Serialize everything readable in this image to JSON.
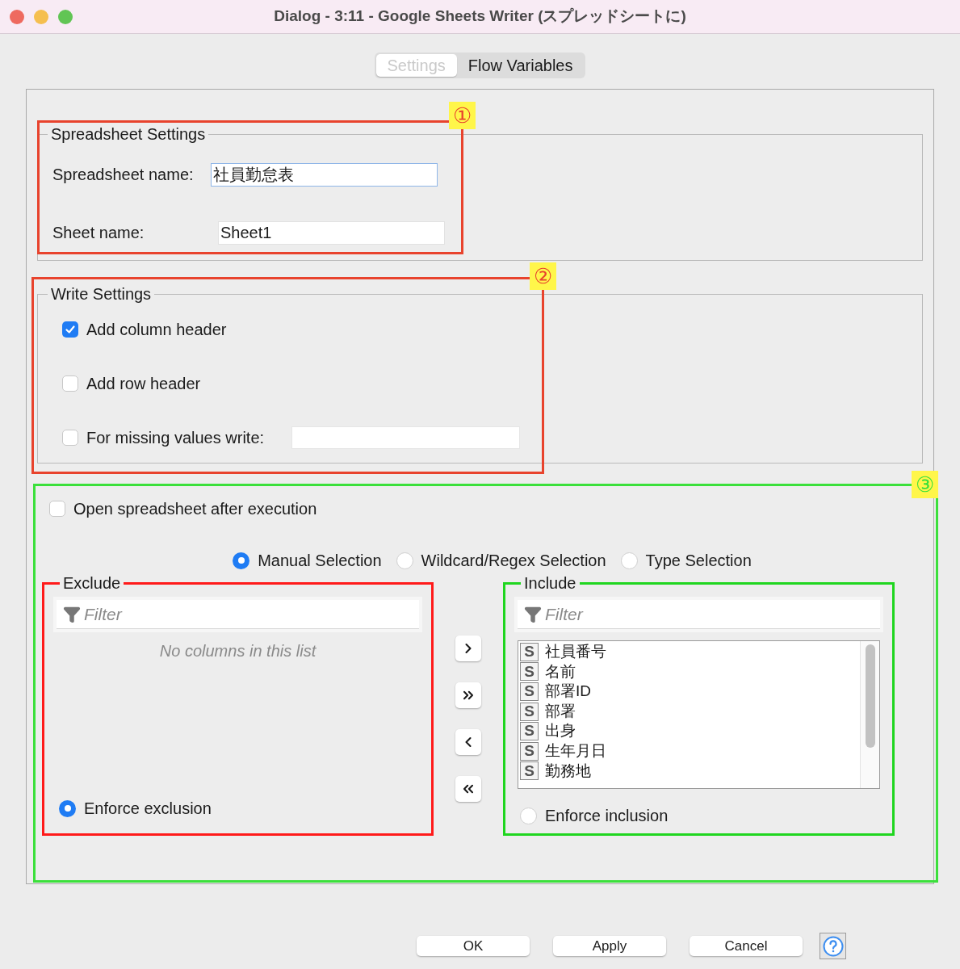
{
  "window": {
    "title": "Dialog - 3:11 - Google Sheets Writer (スプレッドシートに)"
  },
  "tabs": [
    {
      "label": "Settings",
      "selected": true
    },
    {
      "label": "Flow Variables",
      "selected": false
    }
  ],
  "spreadsheet_settings": {
    "title": "Spreadsheet Settings",
    "fields": [
      {
        "label": "Spreadsheet name:",
        "value": "社員勤怠表"
      },
      {
        "label": "Sheet name:",
        "value": "Sheet1"
      }
    ]
  },
  "write_settings": {
    "title": "Write Settings",
    "options": [
      {
        "label": "Add column header",
        "checked": true,
        "kind": "checkbox"
      },
      {
        "label": "Add row header",
        "checked": false,
        "kind": "checkbox"
      },
      {
        "label": "For missing values write:",
        "checked": false,
        "kind": "checkbox-field"
      }
    ]
  },
  "open_after_execution": {
    "label": "Open spreadsheet after execution",
    "checked": false
  },
  "selection_modes": [
    {
      "label": "Manual Selection",
      "selected": true
    },
    {
      "label": "Wildcard/Regex Selection",
      "selected": false
    },
    {
      "label": "Type Selection",
      "selected": false
    }
  ],
  "exclude": {
    "title": "Exclude",
    "filter_placeholder": "Filter",
    "empty_text": "No columns in this list",
    "enforce": {
      "label": "Enforce exclusion",
      "selected": true
    }
  },
  "include": {
    "title": "Include",
    "filter_placeholder": "Filter",
    "columns": [
      {
        "type": "S",
        "name": "社員番号"
      },
      {
        "type": "S",
        "name": "名前"
      },
      {
        "type": "S",
        "name": "部署ID"
      },
      {
        "type": "S",
        "name": "部署"
      },
      {
        "type": "S",
        "name": "出身"
      },
      {
        "type": "S",
        "name": "生年月日"
      },
      {
        "type": "S",
        "name": "勤務地"
      }
    ],
    "enforce": {
      "label": "Enforce inclusion",
      "selected": false
    }
  },
  "buttons": [
    "OK",
    "Apply",
    "Cancel"
  ],
  "annotations": [
    {
      "marker": "①",
      "color": "#e8432d"
    },
    {
      "marker": "②",
      "color": "#e8432d"
    },
    {
      "marker": "③",
      "color": "#3be03b"
    }
  ]
}
